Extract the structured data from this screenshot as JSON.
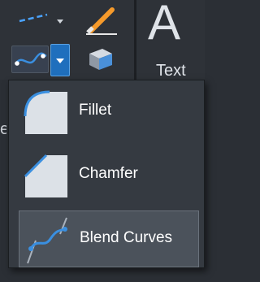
{
  "ribbon": {
    "line_tool_icon": "dashed-line-icon",
    "brush_icon": "match-properties-icon",
    "blend_icon": "blend-curves-icon",
    "dropdown_icon": "chevron-down-icon",
    "box_icon": "3d-box-icon",
    "text_glyph": "A",
    "text_label": "Text"
  },
  "background_text": "e",
  "menu": {
    "items": [
      {
        "label": "Fillet",
        "icon": "fillet-icon"
      },
      {
        "label": "Chamfer",
        "icon": "chamfer-icon"
      },
      {
        "label": "Blend Curves",
        "icon": "blend-curves-icon",
        "highlighted": true
      }
    ]
  },
  "colors": {
    "accent": "#1f6fbd",
    "icon_blue": "#3a8fe0",
    "menu_bg": "#353a41",
    "highlight": "#4b525b",
    "text": "#ffffff"
  }
}
